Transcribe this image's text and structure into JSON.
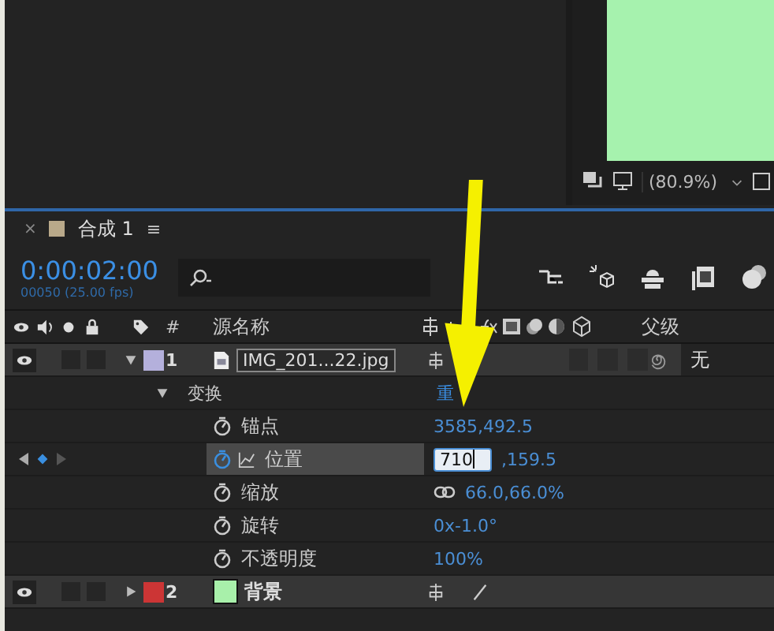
{
  "viewer": {
    "zoom": "(80.9%)"
  },
  "comp_tab": {
    "close": "×",
    "title": "合成 1",
    "menu": "≡",
    "color": "#b9a98a"
  },
  "timecode": "0:00:02:00",
  "frame_info": "00050 (25.00 fps)",
  "columns": {
    "number": "#",
    "source_name": "源名称",
    "parent": "父级"
  },
  "layers": [
    {
      "number": "1",
      "name": "IMG_201...22.jpg",
      "color": "#b4b0dc",
      "kind": "image",
      "expanded": true,
      "switches": [
        {
          "kind": "shy"
        }
      ],
      "parent": "无",
      "group": {
        "label": "变换",
        "reset": "重"
      },
      "properties": [
        {
          "name": "锚点",
          "kind": "plain",
          "value": "3585,492.5",
          "keyframed": false,
          "selected": false
        },
        {
          "name": "位置",
          "kind": "edit",
          "value": "710",
          "rest": ",159.5",
          "keyframed": true,
          "selected": true
        },
        {
          "name": "缩放",
          "kind": "linked",
          "value": "66.0,66.0%",
          "keyframed": false,
          "selected": false
        },
        {
          "name": "旋转",
          "kind": "plain",
          "value": "0x-1.0°",
          "keyframed": false,
          "selected": false
        },
        {
          "name": "不透明度",
          "kind": "plain",
          "value": "100%",
          "keyframed": false,
          "selected": false
        }
      ]
    },
    {
      "number": "2",
      "name": "背景",
      "color": "#cc3535",
      "kind": "solid",
      "swatch": {
        "color": "#a8f0aa"
      },
      "expanded": false,
      "switches": [
        {
          "kind": "shy"
        },
        {
          "kind": "slash"
        }
      ]
    }
  ]
}
